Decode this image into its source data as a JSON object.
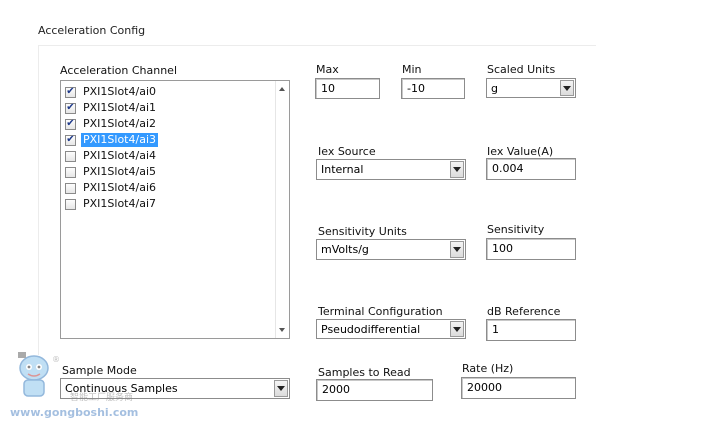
{
  "section": {
    "title": "Acceleration Config"
  },
  "channels": {
    "label": "Acceleration Channel",
    "items": [
      {
        "name": "PXI1Slot4/ai0",
        "checked": true,
        "selected": false
      },
      {
        "name": "PXI1Slot4/ai1",
        "checked": true,
        "selected": false
      },
      {
        "name": "PXI1Slot4/ai2",
        "checked": true,
        "selected": false
      },
      {
        "name": "PXI1Slot4/ai3",
        "checked": true,
        "selected": true
      },
      {
        "name": "PXI1Slot4/ai4",
        "checked": false,
        "selected": false
      },
      {
        "name": "PXI1Slot4/ai5",
        "checked": false,
        "selected": false
      },
      {
        "name": "PXI1Slot4/ai6",
        "checked": false,
        "selected": false
      },
      {
        "name": "PXI1Slot4/ai7",
        "checked": false,
        "selected": false
      }
    ],
    "selection_color": "#3399ff"
  },
  "max": {
    "label": "Max",
    "value": "10"
  },
  "min": {
    "label": "Min",
    "value": "-10"
  },
  "scaled_units": {
    "label": "Scaled Units",
    "value": "g"
  },
  "iex_source": {
    "label": "Iex Source",
    "value": "Internal"
  },
  "iex_value": {
    "label": "Iex Value(A)",
    "value": "0.004"
  },
  "sensitivity_units": {
    "label": "Sensitivity Units",
    "value": "mVolts/g"
  },
  "sensitivity": {
    "label": "Sensitivity",
    "value": "100"
  },
  "terminal_config": {
    "label": "Terminal Configuration",
    "value": "Pseudodifferential"
  },
  "db_reference": {
    "label": "dB Reference",
    "value": "1"
  },
  "sample_mode": {
    "label": "Sample Mode",
    "value": "Continuous Samples"
  },
  "samples_to_read": {
    "label": "Samples to Read",
    "value": "2000"
  },
  "rate": {
    "label": "Rate (Hz)",
    "value": "20000"
  },
  "watermark": {
    "url": "www.gongboshi.com",
    "cn": "智能工厂服务商",
    "icon": "robot-mascot-icon"
  }
}
